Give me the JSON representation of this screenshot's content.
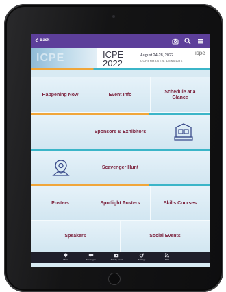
{
  "topbar": {
    "back_label": "Back"
  },
  "banner": {
    "logo_text": "ICPE",
    "event_name": "ICPE\n2022",
    "dates": "August 24-28, 2022",
    "location": "COPENHAGEN, DENMARK",
    "org": "ispe"
  },
  "tiles": {
    "happening_now": "Happening Now",
    "event_info": "Event Info",
    "schedule": "Schedule at a Glance",
    "sponsors": "Sponsors & Exhibitors",
    "scavenger": "Scavenger Hunt",
    "posters": "Posters",
    "spotlight_posters": "Spotlight Posters",
    "skills_courses": "Skills Courses",
    "speakers": "Speakers",
    "social_events": "Social Events"
  },
  "tabs": [
    {
      "label": "Maps",
      "icon": "map-pin-icon"
    },
    {
      "label": "Messages",
      "icon": "messages-icon"
    },
    {
      "label": "Activity Feed",
      "icon": "camera-icon"
    },
    {
      "label": "Settings",
      "icon": "gear-icon"
    },
    {
      "label": "RSS",
      "icon": "rss-icon"
    }
  ],
  "colors": {
    "topbar": "#5d3f9a",
    "tile_text": "#7a1f3a",
    "accent_orange": "#f0a63a",
    "accent_teal": "#3bb5c8",
    "tabbar": "#1e1e2a"
  }
}
